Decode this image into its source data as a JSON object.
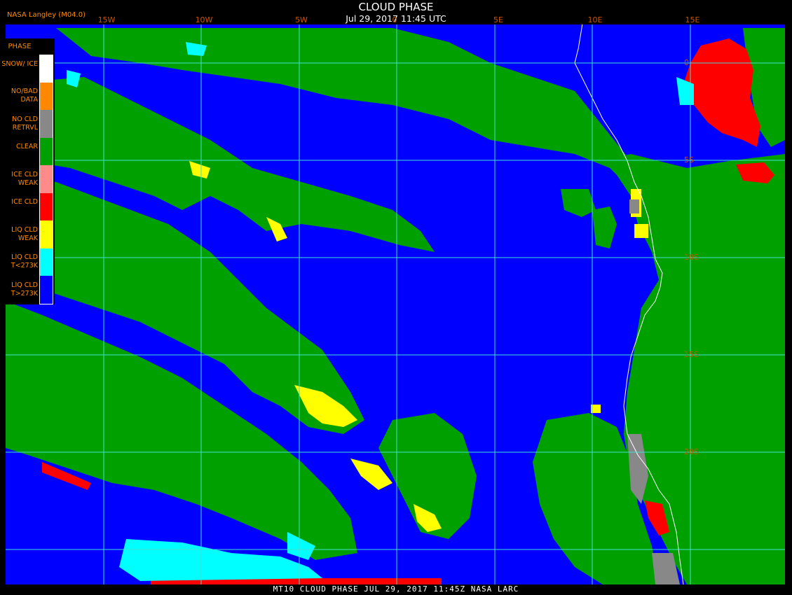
{
  "header": {
    "title": "CLOUD PHASE",
    "subtitle": "Jul 29, 2017 11:45 UTC",
    "source": "NASA Langley (M04.0)"
  },
  "footer": {
    "text": "MT10  CLOUD PHASE   JUL 29, 2017 11:45Z   NASA LARC"
  },
  "map": {
    "lon_labels": [
      "15W",
      "10W",
      "5W",
      "0",
      "5E",
      "10E",
      "15E"
    ],
    "lat_labels": [
      "0",
      "5S",
      "10S",
      "15S",
      "20S"
    ],
    "grid_color": "#40e0d0",
    "label_color": "#cc5500"
  },
  "legend": {
    "title": "PHASE",
    "items": [
      {
        "label": "SNOW/ ICE",
        "color": "#ffffff"
      },
      {
        "label": "NO/BAD DATA",
        "color": "#ff8800"
      },
      {
        "label": "NO CLD RETRVL",
        "color": "#888888"
      },
      {
        "label": "CLEAR",
        "color": "#00a000"
      },
      {
        "label": "ICE CLD WEAK",
        "color": "#ff8a8a"
      },
      {
        "label": "ICE CLD",
        "color": "#ff0000"
      },
      {
        "label": "LIQ CLD WEAK",
        "color": "#ffff00"
      },
      {
        "label": "LIQ CLD T<273K",
        "color": "#00ffff"
      },
      {
        "label": "LIQ CLD T>273K",
        "color": "#0000ff"
      }
    ]
  }
}
